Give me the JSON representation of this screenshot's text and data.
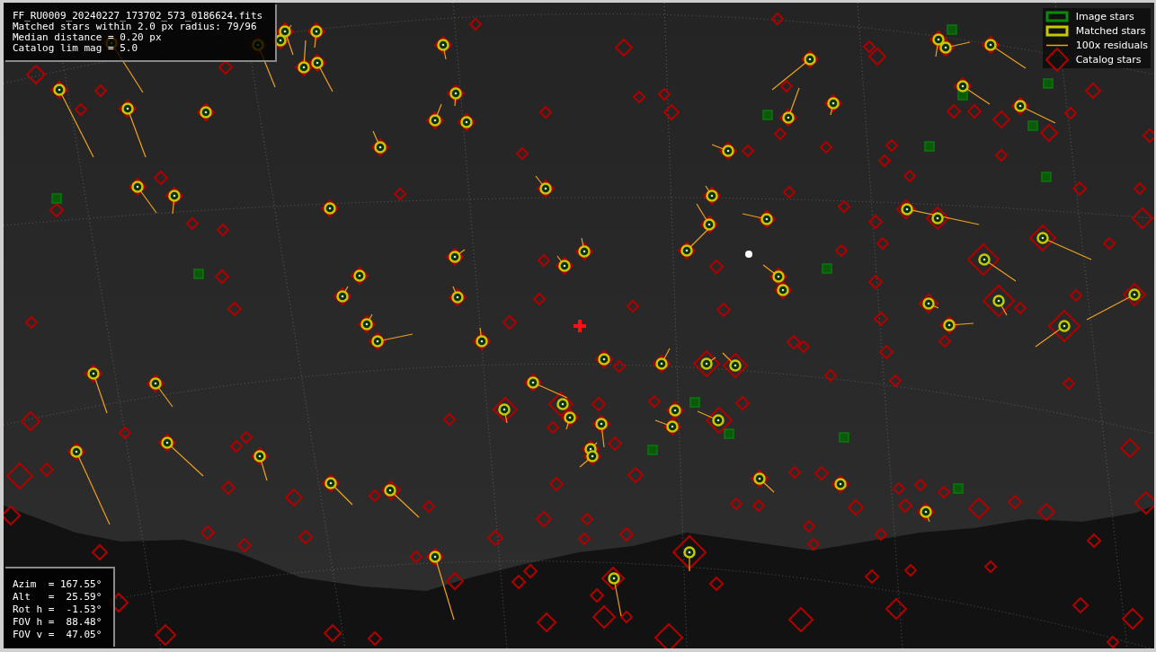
{
  "file_info": {
    "lines": [
      "FF_RU0009_20240227_173702_573_0186624.fits",
      "Matched stars within 2.0 px radius: 79/96",
      "Median distance = 0.20 px",
      "Catalog lim mag = 5.0"
    ]
  },
  "legend": {
    "items": [
      {
        "kind": "image",
        "label": "Image stars"
      },
      {
        "kind": "matched",
        "label": "Matched stars"
      },
      {
        "kind": "residual",
        "label": "100x residuals"
      },
      {
        "kind": "catalog",
        "label": "Catalog stars"
      }
    ]
  },
  "pointing": {
    "lines": [
      "Azim  = 167.55°",
      "Alt   =  25.59°",
      "Rot h =  -1.53°",
      "FOV h =  88.48°",
      "FOV v =  47.05°"
    ]
  }
}
